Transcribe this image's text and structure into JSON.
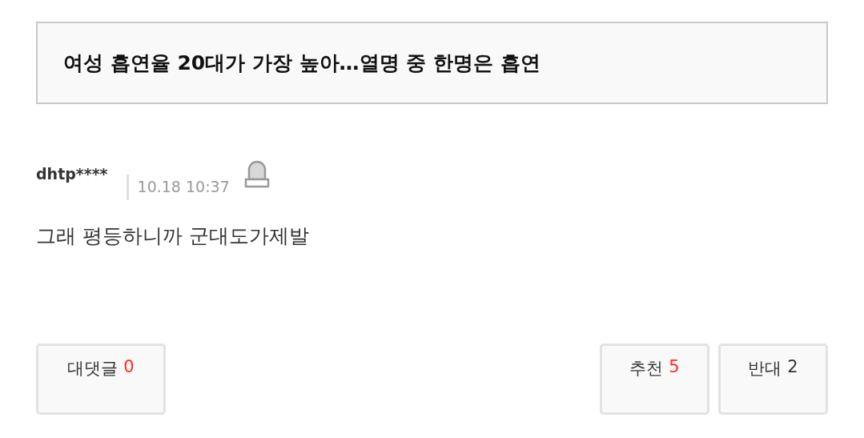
{
  "article_title": "여성 흡연율 20대가 가장 높아…열명 중 한명은 흡연",
  "comment": {
    "author": "dhtp****",
    "time": "10.18 10:37",
    "text": "그래 평등하니까 군대도가제발"
  },
  "buttons": [
    {
      "label": "대댓글",
      "count": "0",
      "color": "#ff2a1f"
    },
    {
      "label": "추천",
      "count": "5",
      "color": "#ff2a1f"
    },
    {
      "label": "반대",
      "count": "2",
      "color": "#333333"
    }
  ]
}
